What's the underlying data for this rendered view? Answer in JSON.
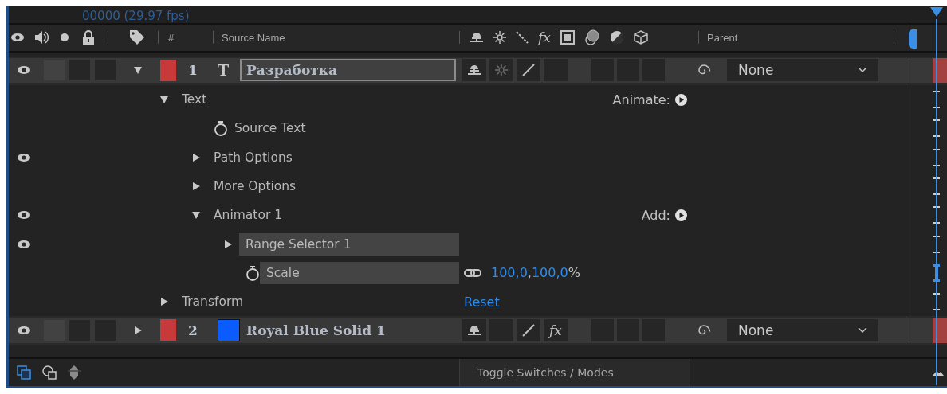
{
  "timecode": "00000 (29.97 fps)",
  "header": {
    "number_label": "#",
    "source_name": "Source Name",
    "parent": "Parent",
    "switch_icons": [
      {
        "kind": "shy"
      },
      {
        "kind": "collapse"
      },
      {
        "kind": "quality"
      },
      {
        "kind": "fx",
        "text": "fx"
      },
      {
        "kind": "film"
      },
      {
        "kind": "blur"
      },
      {
        "kind": "adjustment"
      },
      {
        "kind": "cube"
      }
    ]
  },
  "layers": [
    {
      "number": "1",
      "visible": true,
      "expanded": true,
      "label": {
        "color": "#c83a3a"
      },
      "kind": "text",
      "type_glyph": "T",
      "name": "Разработка",
      "editing": true,
      "parent": "None",
      "av_switches": [
        {
          "on": false
        },
        {
          "on": false
        },
        {
          "on": false
        }
      ],
      "switches": [
        {
          "kind": "shy",
          "on": true
        },
        {
          "kind": "collapse",
          "on": false
        },
        {
          "kind": "quality",
          "on": true
        },
        {
          "kind": "empty"
        },
        {
          "kind": "film",
          "on": false
        },
        {
          "kind": "blur",
          "on": false
        },
        {
          "kind": "adjustment",
          "on": false
        }
      ],
      "children": [
        {
          "kind": "group",
          "name": "Text",
          "visible": false,
          "expanded": true,
          "highlighted": false,
          "selected": false,
          "action": "Animate:",
          "children": [
            {
              "kind": "property",
              "name": "Source Text",
              "visible": false,
              "highlighted": false,
              "selected": false
            },
            {
              "kind": "group",
              "name": "Path Options",
              "visible": true,
              "expanded": false,
              "highlighted": false,
              "selected": false
            },
            {
              "kind": "group",
              "name": "More Options",
              "visible": false,
              "expanded": false,
              "highlighted": false,
              "selected": false
            },
            {
              "kind": "group",
              "name": "Animator 1",
              "visible": true,
              "expanded": true,
              "highlighted": false,
              "selected": false,
              "action": "Add:",
              "children": [
                {
                  "kind": "group",
                  "name": "Range Selector 1",
                  "visible": true,
                  "expanded": false,
                  "highlighted": true,
                  "selected": false
                },
                {
                  "kind": "property",
                  "name": "Scale",
                  "visible": false,
                  "highlighted": true,
                  "selected": true,
                  "linked": true,
                  "value": [
                    {
                      "kind": "number",
                      "text": "100,0"
                    },
                    {
                      "kind": "plain",
                      "text": ","
                    },
                    {
                      "kind": "number",
                      "text": "100,0"
                    },
                    {
                      "kind": "plain",
                      "text": "%"
                    }
                  ]
                }
              ]
            }
          ]
        },
        {
          "kind": "group",
          "name": "Transform",
          "visible": false,
          "expanded": false,
          "highlighted": false,
          "selected": false,
          "link": "Reset"
        }
      ]
    },
    {
      "number": "2",
      "visible": true,
      "expanded": false,
      "label": {
        "color": "#c83a3a"
      },
      "kind": "solid",
      "solid": {
        "color": "#0a5cff"
      },
      "name": "Royal Blue Solid 1",
      "editing": false,
      "parent": "None",
      "av_switches": [
        {
          "on": false
        },
        {
          "on": false
        },
        {
          "on": false
        }
      ],
      "switches": [
        {
          "kind": "shy",
          "on": true
        },
        {
          "kind": "empty"
        },
        {
          "kind": "quality",
          "on": true
        },
        {
          "kind": "fx",
          "text": "fx",
          "on": true
        },
        {
          "kind": "film",
          "on": false
        },
        {
          "kind": "blur",
          "on": false
        },
        {
          "kind": "adjustment",
          "on": false
        }
      ]
    }
  ],
  "footer": {
    "toggle_label": "Toggle Switches / Modes"
  }
}
